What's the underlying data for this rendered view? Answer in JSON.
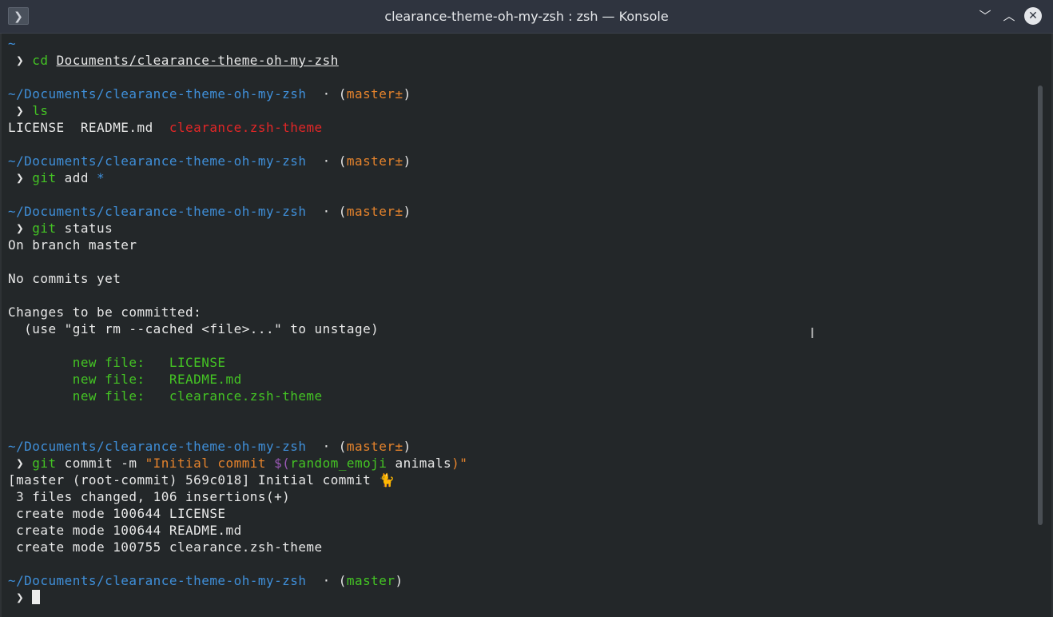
{
  "window": {
    "title": "clearance-theme-oh-my-zsh : zsh — Konsole",
    "app_icon": "terminal-icon",
    "controls": [
      "minimize",
      "maximize",
      "close"
    ]
  },
  "colors": {
    "path": "#3f8fd9",
    "command": "#44c424",
    "branch": "#e5832c",
    "theme_file": "#e32727",
    "new_file": "#44c424"
  },
  "terminal": {
    "prompt_char": " ❯ ",
    "home": "~",
    "path": "~/Documents/clearance-theme-oh-my-zsh",
    "sep": "  · (",
    "close_paren": ")",
    "branch_dirty": "master±",
    "branch_clean": "master",
    "cmd_cd": "cd",
    "cd_arg": "Documents/clearance-theme-oh-my-zsh",
    "cmd_ls": "ls",
    "ls_license": "LICENSE",
    "ls_readme": "README.md",
    "ls_theme": "clearance.zsh-theme",
    "cmd_git": "git",
    "add_arg": "add",
    "add_glob": "*",
    "status_arg": "status",
    "status_branch": "On branch master",
    "status_commits": "No commits yet",
    "status_changes": "Changes to be committed:",
    "status_hint": "  (use \"git rm --cached <file>...\" to unstage)",
    "new_file_label": "        new file:   ",
    "new_files": [
      "LICENSE",
      "README.md",
      "clearance.zsh-theme"
    ],
    "commit_arg": "commit -m",
    "commit_str1": "\"Initial commit ",
    "commit_dollar": "$(",
    "commit_fn": "random_emoji",
    "commit_animals": " animals",
    "commit_str2": ")\"",
    "commit_result": "[master (root-commit) 569c018] Initial commit 🐈",
    "commit_stats": " 3 files changed, 106 insertions(+)",
    "create_modes": [
      " create mode 100644 LICENSE",
      " create mode 100644 README.md",
      " create mode 100755 clearance.zsh-theme"
    ]
  }
}
